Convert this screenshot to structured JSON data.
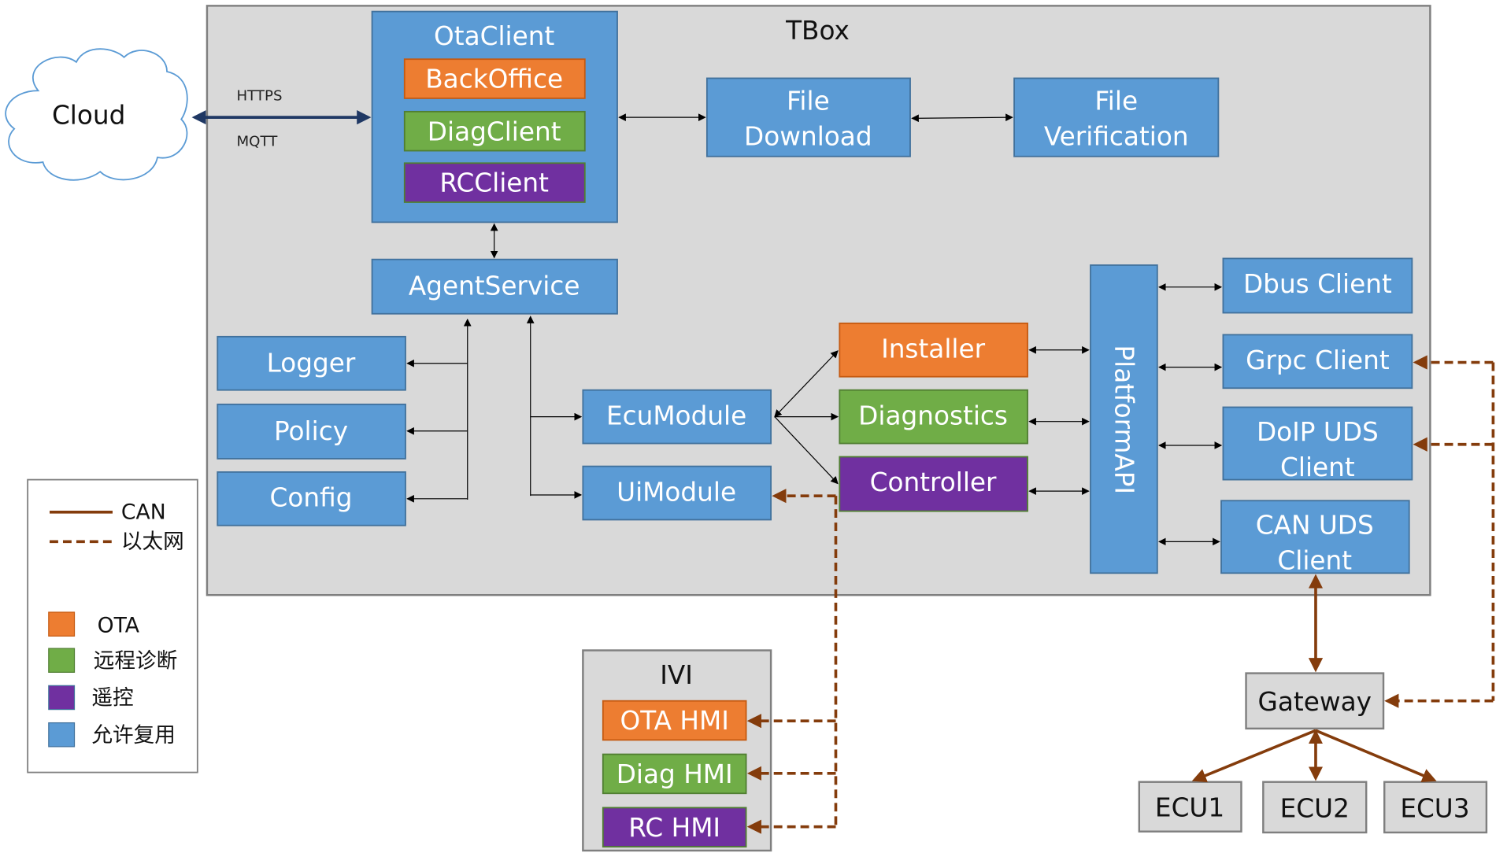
{
  "colors": {
    "reusable": "#5b9bd5",
    "ota": "#ed7d31",
    "diag": "#70ad47",
    "rc": "#7030a0",
    "container": "#d9d9d9",
    "can_link": "#843c0c",
    "cloud_link": "#1f3864"
  },
  "cloud": {
    "label": "Cloud",
    "protocols": [
      "HTTPS",
      "MQTT"
    ]
  },
  "tbox": {
    "label": "TBox",
    "ota_client": {
      "label": "OtaClient",
      "modules": [
        "BackOffice",
        "DiagClient",
        "RCClient"
      ]
    },
    "file_download": [
      "File",
      "Download"
    ],
    "file_verification": [
      "File",
      "Verification"
    ],
    "agent_service": "AgentService",
    "services": [
      "Logger",
      "Policy",
      "Config"
    ],
    "ecu_module": "EcuModule",
    "ui_module": "UiModule",
    "handlers": [
      "Installer",
      "Diagnostics",
      "Controller"
    ],
    "platform_api": "PlatformAPI",
    "clients": {
      "dbus": [
        "Dbus Client"
      ],
      "grpc": [
        "Grpc Client"
      ],
      "doip": [
        "DoIP UDS",
        "Client"
      ],
      "can": [
        "CAN UDS",
        "Client"
      ]
    }
  },
  "ivi": {
    "label": "IVI",
    "hmis": [
      "OTA HMI",
      "Diag HMI",
      "RC HMI"
    ]
  },
  "gateway": "Gateway",
  "ecus": [
    "ECU1",
    "ECU2",
    "ECU3"
  ],
  "legend": {
    "lines": [
      {
        "label": "CAN",
        "style": "solid"
      },
      {
        "label": "以太网",
        "style": "dashed"
      }
    ],
    "swatches": [
      {
        "label": "OTA",
        "color": "#ed7d31"
      },
      {
        "label": "远程诊断",
        "color": "#70ad47"
      },
      {
        "label": "遥控",
        "color": "#7030a0"
      },
      {
        "label": "允许复用",
        "color": "#5b9bd5"
      }
    ]
  }
}
